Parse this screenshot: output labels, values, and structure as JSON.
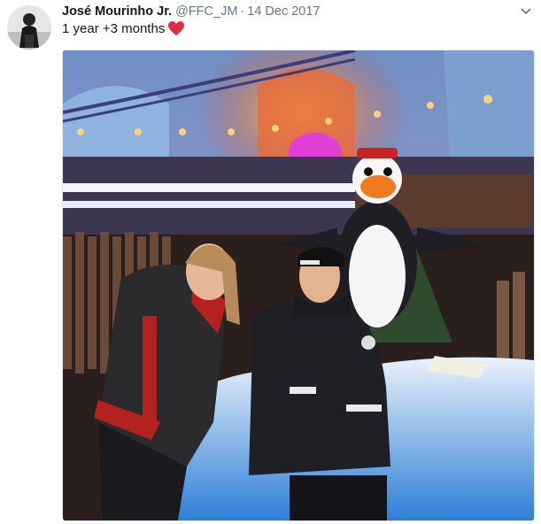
{
  "tweet": {
    "display_name": "José Mourinho Jr.",
    "handle": "@FFC_JM",
    "separator": "·",
    "timestamp": "14 Dec 2017",
    "text": "1 year +3 months",
    "emoji_icon": "red-heart-icon"
  },
  "colors": {
    "heart": "#dd2e44",
    "name": "#14171a",
    "secondary": "#657786"
  },
  "media": {
    "description_icons": [
      "avatar-photo",
      "tweet-photo"
    ]
  }
}
